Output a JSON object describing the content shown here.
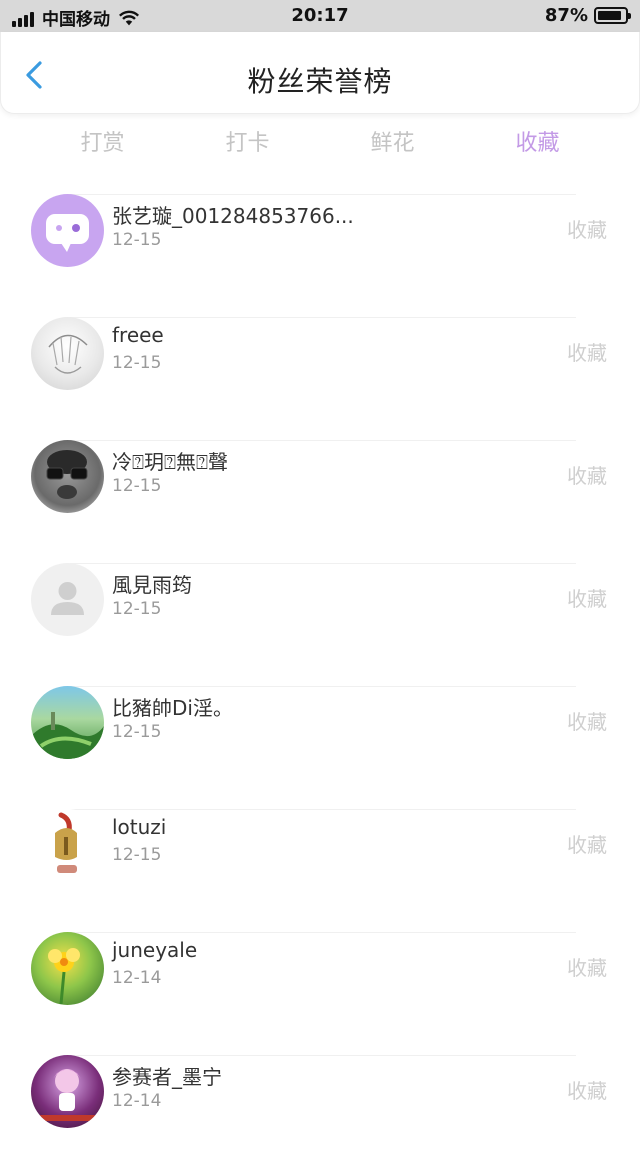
{
  "status_bar": {
    "carrier": "中国移动",
    "time": "20:17",
    "battery_text": "87%",
    "battery_level": 0.87
  },
  "header": {
    "title": "粉丝荣誉榜",
    "accent_color": "#3a9be0"
  },
  "tabs": [
    {
      "label": "打赏",
      "active": false
    },
    {
      "label": "打卡",
      "active": false
    },
    {
      "label": "鲜花",
      "active": false
    },
    {
      "label": "收藏",
      "active": true
    }
  ],
  "active_tab_color": "#c39ae6",
  "fans": [
    {
      "name": "张艺璇_001284853766...",
      "date": "12-15",
      "action": "收藏",
      "avatar": "purple-chat-icon"
    },
    {
      "name": "freee",
      "date": "12-15",
      "action": "收藏",
      "avatar": "sketch-photo"
    },
    {
      "name": "冷⍰玥⍰無⍰聲",
      "date": "12-15",
      "action": "收藏",
      "avatar": "grayscale-photo"
    },
    {
      "name": "風見雨筠",
      "date": "12-15",
      "action": "收藏",
      "avatar": "default-user-icon"
    },
    {
      "name": "比豬帥Di淫。",
      "date": "12-15",
      "action": "收藏",
      "avatar": "landscape-photo"
    },
    {
      "name": "lotuzi",
      "date": "12-15",
      "action": "收藏",
      "avatar": "helmet-photo"
    },
    {
      "name": "juneyale",
      "date": "12-14",
      "action": "收藏",
      "avatar": "flower-photo"
    },
    {
      "name": "参赛者_墨宁",
      "date": "12-14",
      "action": "收藏",
      "avatar": "anime-photo"
    }
  ]
}
